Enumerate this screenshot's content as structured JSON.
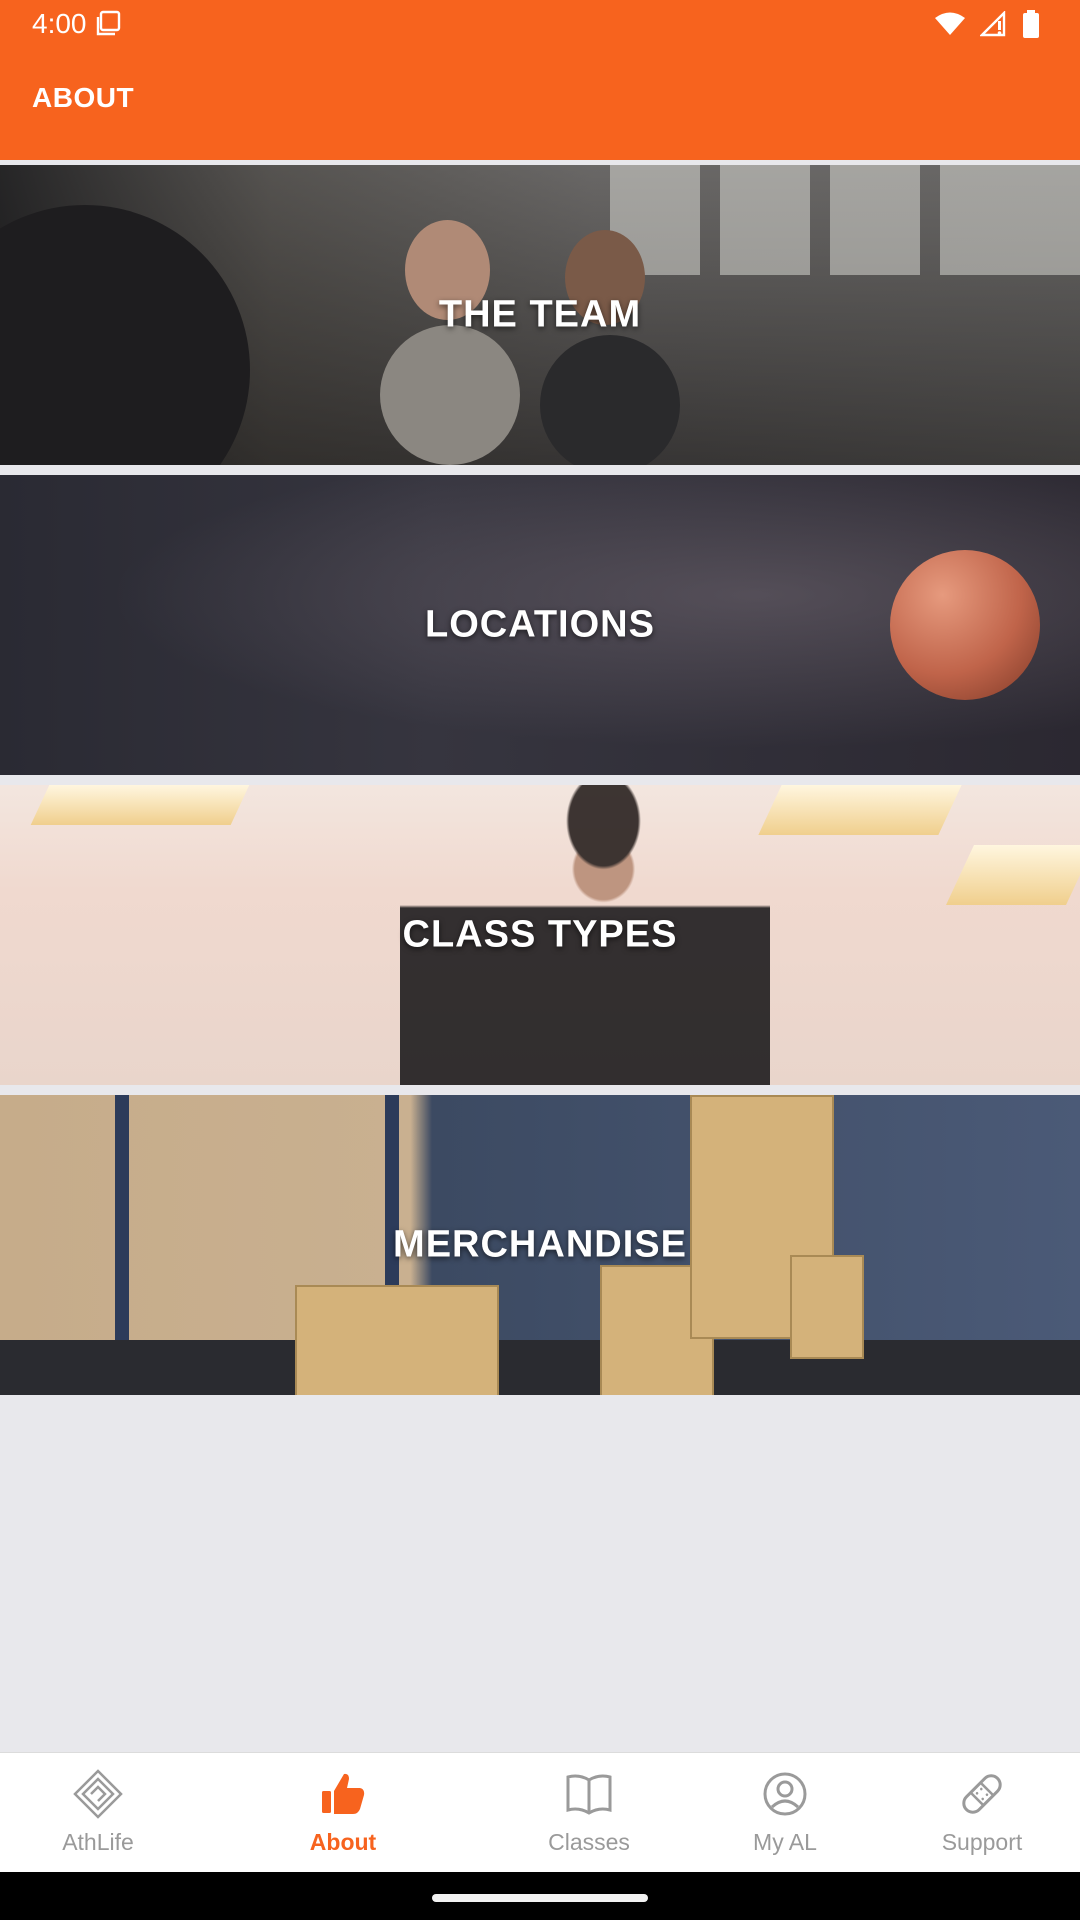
{
  "status_bar": {
    "time": "4:00"
  },
  "app_bar": {
    "title": "ABOUT",
    "background_color": "#f7631e"
  },
  "cards": [
    {
      "label": "THE TEAM"
    },
    {
      "label": "LOCATIONS"
    },
    {
      "label": "CLASS TYPES"
    },
    {
      "label": "MERCHANDISE"
    }
  ],
  "bottom_nav": {
    "active_color": "#f7631e",
    "inactive_color": "#9a9a9a",
    "items": [
      {
        "label": "AthLife",
        "icon": "athlife-logo-icon",
        "active": false
      },
      {
        "label": "About",
        "icon": "thumbs-up-icon",
        "active": true
      },
      {
        "label": "Classes",
        "icon": "book-icon",
        "active": false
      },
      {
        "label": "My AL",
        "icon": "account-circle-icon",
        "active": false
      },
      {
        "label": "Support",
        "icon": "bandage-icon",
        "active": false
      }
    ]
  }
}
